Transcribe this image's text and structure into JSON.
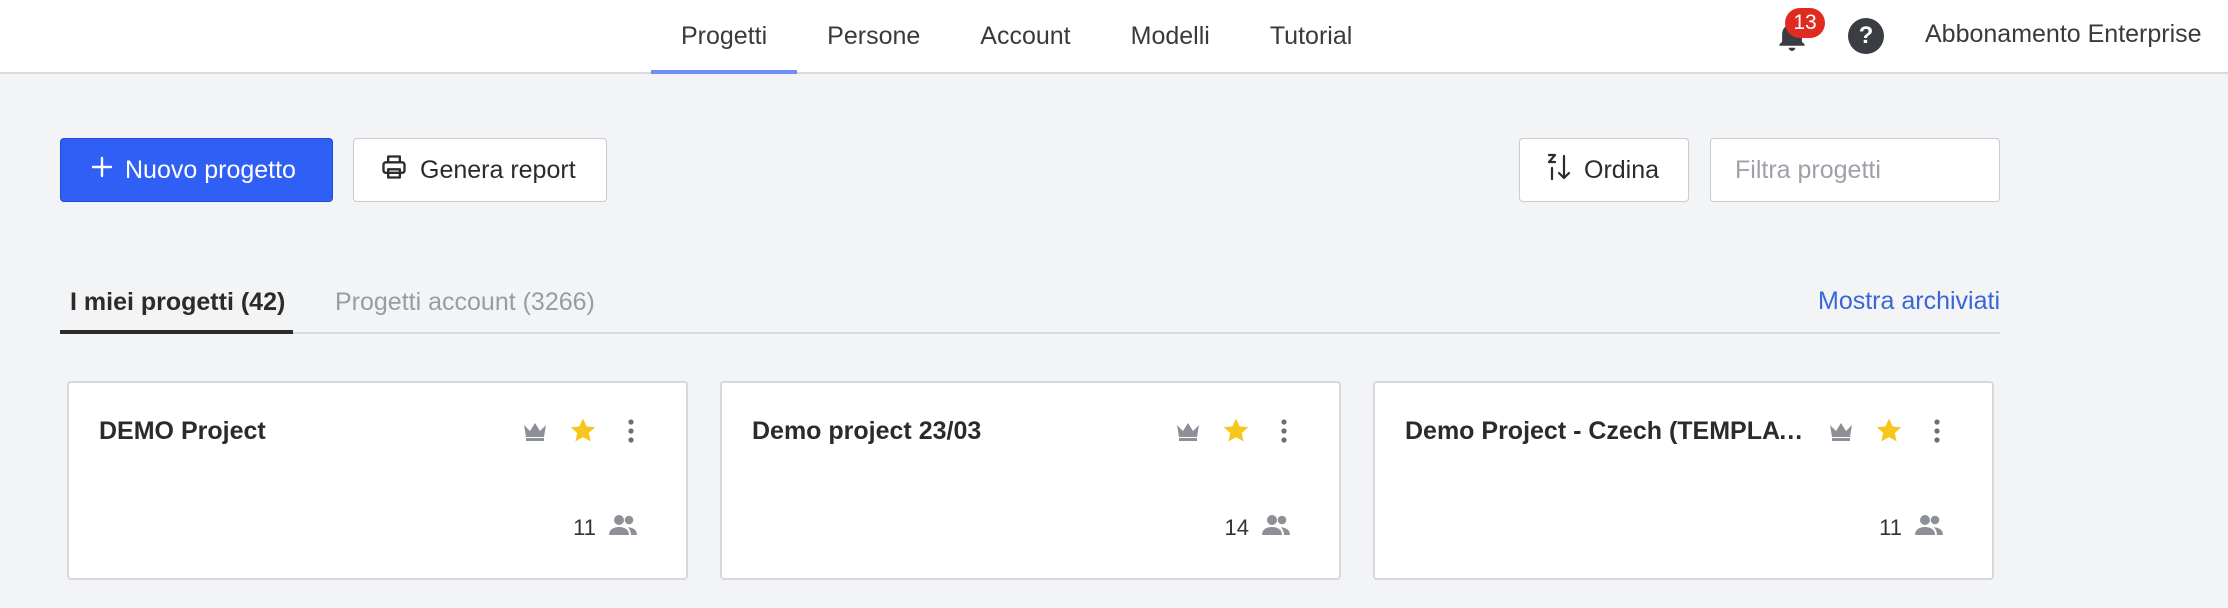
{
  "nav": {
    "tabs": [
      {
        "label": "Progetti",
        "active": true
      },
      {
        "label": "Persone",
        "active": false
      },
      {
        "label": "Account",
        "active": false
      },
      {
        "label": "Modelli",
        "active": false
      },
      {
        "label": "Tutorial",
        "active": false
      }
    ],
    "notifications_count": "13",
    "help_label": "?",
    "plan_label": "Abbonamento Enterprise"
  },
  "toolbar": {
    "new_project_label": "Nuovo progetto",
    "report_label": "Genera report",
    "sort_label": "Ordina",
    "filter_placeholder": "Filtra progetti"
  },
  "project_tabs": {
    "mine_label": "I miei progetti (42)",
    "account_label": "Progetti account (3266)",
    "show_archived_label": "Mostra archiviati"
  },
  "projects": [
    {
      "name": "DEMO Project",
      "members": "11",
      "starred": true
    },
    {
      "name": "Demo project 23/03",
      "members": "14",
      "starred": true
    },
    {
      "name": "Demo Project - Czech (TEMPLATE)",
      "members": "11",
      "starred": true
    }
  ],
  "colors": {
    "primary": "#2f5ff5",
    "star": "#f7c51e",
    "badge": "#e02b21",
    "link": "#3a66d6",
    "nav_active_underline": "#6f8ff3"
  },
  "icons": {
    "notifications": "bell-icon",
    "help": "question-icon",
    "new_project": "plus-icon",
    "report": "printer-icon",
    "sort": "sort-icon",
    "owner": "crown-icon",
    "favorite": "star-icon",
    "menu": "more-vertical-icon",
    "members": "people-icon"
  }
}
